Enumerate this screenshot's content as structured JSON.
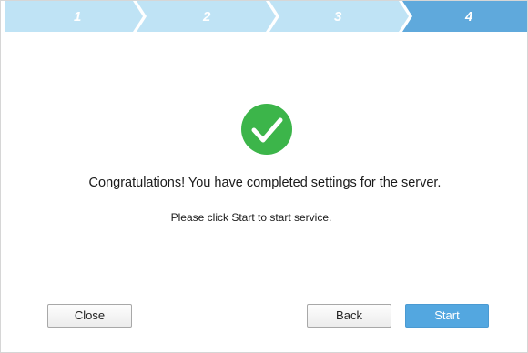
{
  "wizard": {
    "steps": [
      {
        "label": "1",
        "state": "done"
      },
      {
        "label": "2",
        "state": "done"
      },
      {
        "label": "3",
        "state": "done"
      },
      {
        "label": "4",
        "state": "current"
      }
    ],
    "colors": {
      "step_inactive": "#bfe3f5",
      "step_active": "#5fa9dc",
      "success": "#3cb54a",
      "primary_button": "#53a7e0"
    }
  },
  "content": {
    "icon": "check-circle-icon",
    "message": "Congratulations! You have completed settings for the server.",
    "sub_message": "Please click Start to start service."
  },
  "buttons": {
    "close": "Close",
    "back": "Back",
    "start": "Start"
  }
}
